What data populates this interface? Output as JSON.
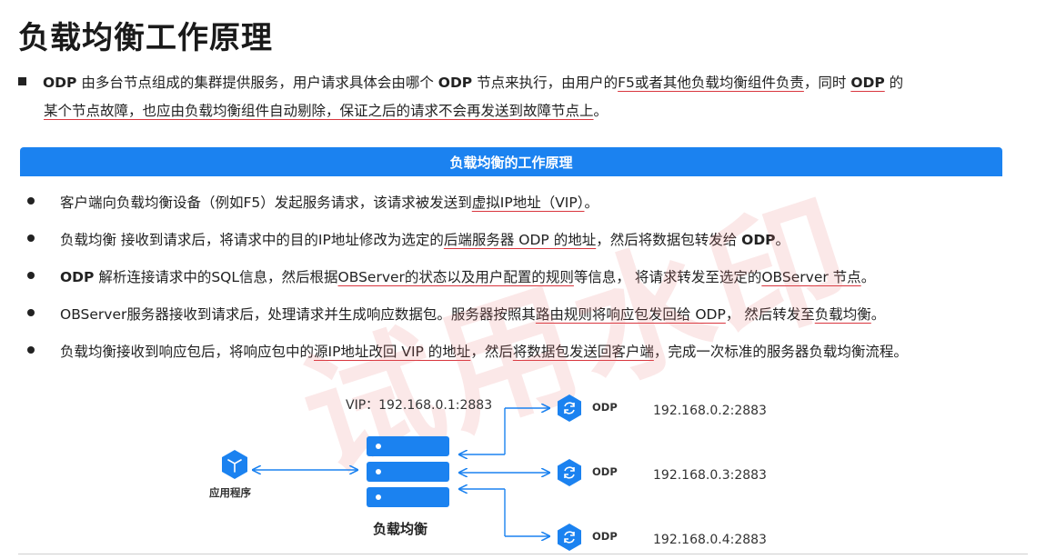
{
  "page": {
    "title": "负载均衡工作原理",
    "watermark": "试用水印"
  },
  "intro": {
    "p1": "ODP",
    "p2": " 由多台节点组成的集群提供服务，用户请求具体会由哪个 ",
    "p3": "ODP",
    "p4": " 节点来执行，由用户的",
    "p5": "F5或者其他负载均衡组件负责",
    "p6": "，同时 ",
    "p7": "ODP",
    "p8": " 的",
    "p9": "某个节点故障，也应由负载均衡组件自动剔除，保证之后的请求不会再发送到故障节点上",
    "p10": "。"
  },
  "banner": {
    "title": "负载均衡的工作原理"
  },
  "bullets": [
    {
      "a": "客户端向负载均衡设备（例如F5）发起服务请求，该请求被发送到",
      "b": "虚拟IP地址（VIP）",
      "c": "。"
    },
    {
      "a": "负载均衡 接收到请求后，将请求中的目的IP地址修改为选定的",
      "b": "后端服务器 ODP 的地址",
      "c": "，然后将数据包转发给 ",
      "d": "ODP",
      "e": "。"
    },
    {
      "a": "ODP",
      "b": " 解析连接请求中的SQL信息，然后根据",
      "c": "OBServer的状态以及用户配置的规则",
      "d": "等信息， 将请求转发至选定的",
      "e": "OBServer 节点",
      "f": "。"
    },
    {
      "a": "OBServer服务器接收到请求后，处理请求并生成响应数据包。服务器按照其",
      "b": "路由规则将响应包发回给 ODP",
      "c": "， 然后转发至",
      "d": "负载均衡",
      "e": "。"
    },
    {
      "a": "负载均衡接收到响应包后，将响应包中的",
      "b": "源IP地址改回 VIP 的地址",
      "c": "，然后",
      "d": "将数据包发送回客户端",
      "e": "，完成一次标准的服务器负载均衡流程。"
    }
  ],
  "diagram": {
    "vip": "VIP：192.168.0.1:2883",
    "client_label": "应用程序",
    "lb_label": "负载均衡",
    "nodes": [
      {
        "label": "ODP",
        "address": "192.168.0.2:2883"
      },
      {
        "label": "ODP",
        "address": "192.168.0.3:2883"
      },
      {
        "label": "ODP",
        "address": "192.168.0.4:2883"
      }
    ],
    "icons": {
      "client": "cube-icon",
      "server": "server-stack-icon",
      "node": "sync-icon"
    },
    "colors": {
      "accent": "#1b82f0",
      "underline": "#d9363e"
    }
  }
}
